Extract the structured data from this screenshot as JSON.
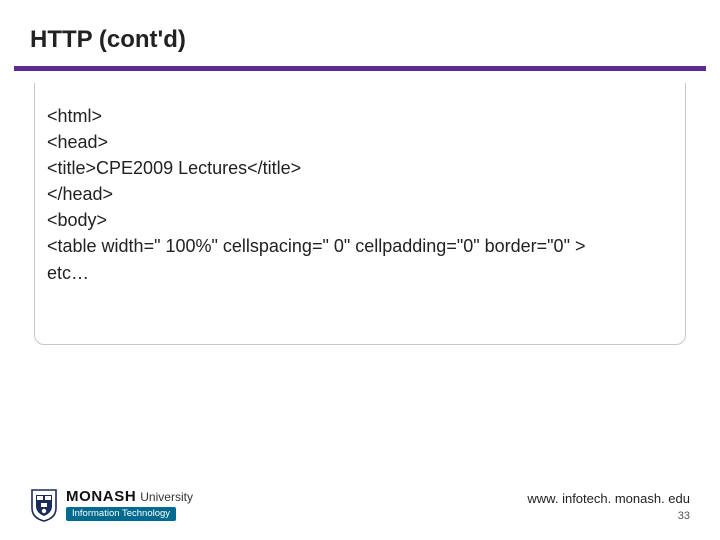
{
  "title": "HTTP (cont'd)",
  "code_lines": [
    "<html>",
    "<head>",
    "<title>CPE2009 Lectures</title>",
    "</head>",
    "<body>",
    "<table width=\" 100%\" cellspacing=\" 0\" cellpadding=\"0\" border=\"0\" >",
    "etc…"
  ],
  "footer": {
    "url": "www. infotech. monash. edu",
    "slide_number": "33"
  },
  "logo": {
    "monash": "MONASH",
    "university": "University",
    "subunit": "Information Technology"
  },
  "colors": {
    "accent": "#5c2d91",
    "logo_bar": "#006b8f"
  }
}
